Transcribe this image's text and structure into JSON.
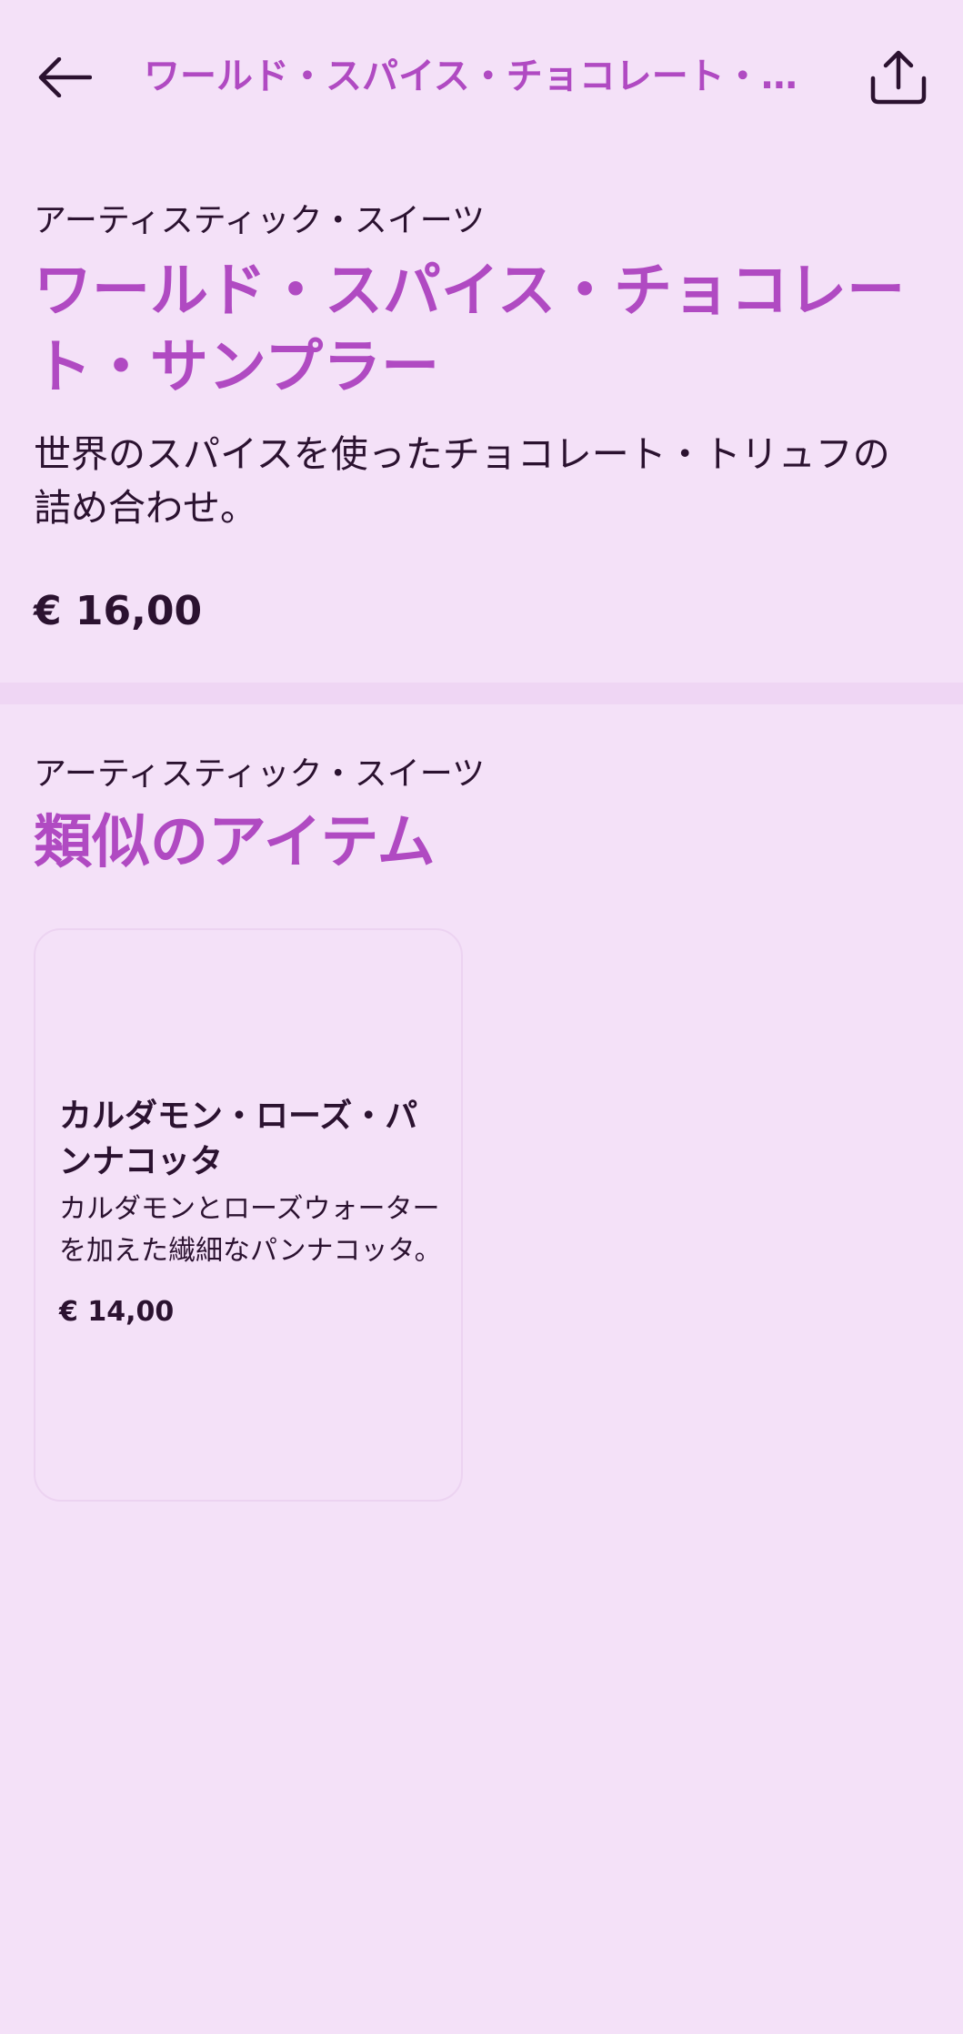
{
  "app_bar": {
    "title": "ワールド・スパイス・チョコレート・サンプラー",
    "back_icon": "arrow-left-icon",
    "share_icon": "share-icon"
  },
  "product": {
    "category": "アーティスティック・スイーツ",
    "title": "ワールド・スパイス・チョコレート・サンプラー",
    "description": "世界のスパイスを使ったチョコレート・トリュフの詰め合わせ。",
    "price": "€ 16,00"
  },
  "similar": {
    "category": "アーティスティック・スイーツ",
    "title": "類似のアイテム",
    "items": [
      {
        "title": "カルダモン・ローズ・パンナコッタ",
        "description": "カルダモンとローズウォーターを加えた繊細なパンナコッタ。",
        "price": "€ 14,00"
      }
    ]
  },
  "colors": {
    "background": "#F4E1F8",
    "accent": "#B04AC2",
    "text": "#2B1230",
    "divider": "#EFD6F4"
  }
}
